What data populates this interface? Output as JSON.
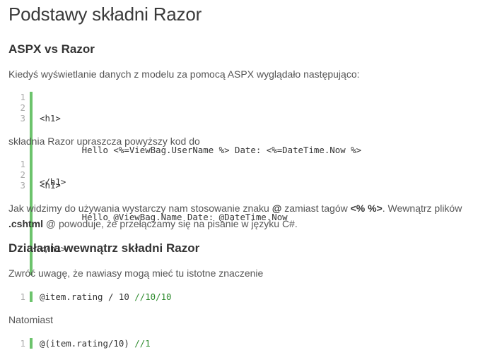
{
  "title": "Podstawy składni Razor",
  "sections": [
    {
      "heading": "ASPX vs Razor"
    },
    {
      "heading": "Działania wewnątrz składni Razor"
    }
  ],
  "paragraphs": {
    "p1": "Kiedyś wyświetlanie danych z modelu za pomocą ASPX wyglądało następująco:",
    "p2": "składnia Razor upraszcza powyższy kod do",
    "p3_a": "Jak widzimy do używania wystarczy nam stosowanie znaku ",
    "p3_at": "@",
    "p3_b": " zamiast tagów ",
    "p3_tags": "<% %>",
    "p3_c": ". Wewnątrz plików ",
    "p3_cshtml": ".cshtml",
    "p3_d": " @ powoduje, że przełączamy się na pisanie w języku C#.",
    "p4": "Zwróć uwagę, że nawiasy mogą mieć tu istotne znaczenie",
    "p5": "Natomiast"
  },
  "code_blocks": [
    {
      "numbers": [
        "1",
        "2",
        "3"
      ],
      "lines": [
        "<h1>",
        "        Hello <%=ViewBag.UserName %> Date: <%=DateTime.Now %>",
        "</h1>"
      ]
    },
    {
      "numbers": [
        "1",
        "2",
        "3"
      ],
      "lines": [
        "<h1>",
        "        Hello @ViewBag.Name Date: @DateTime.Now",
        "</h1>"
      ]
    },
    {
      "numbers": [
        "1"
      ],
      "code": "@item.rating / 10 ",
      "comment": "//10/10"
    },
    {
      "numbers": [
        "1"
      ],
      "code": "@(item.rating/10) ",
      "comment": "//1"
    }
  ],
  "colors": {
    "accent_bar": "#6cc36c",
    "comment": "#2e8b2e"
  }
}
